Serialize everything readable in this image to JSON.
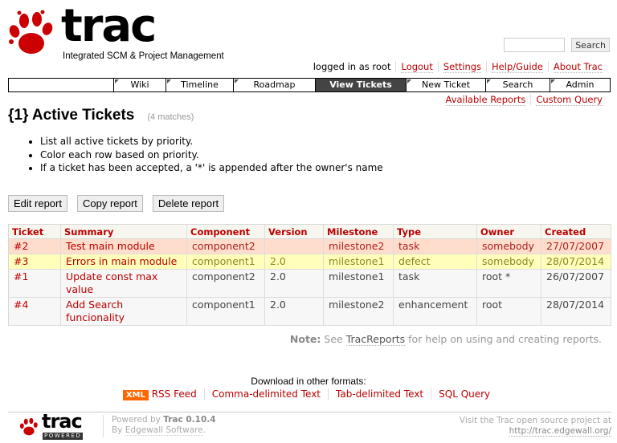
{
  "header": {
    "logo_word": "trac",
    "logo_tagline": "Integrated SCM & Project Management",
    "search_placeholder": "",
    "search_button": "Search"
  },
  "metanav": {
    "logged_in": "logged in as root",
    "items": [
      "Logout",
      "Settings",
      "Help/Guide",
      "About Trac"
    ]
  },
  "mainnav": {
    "tabs": [
      {
        "label": "Wiki",
        "active": false
      },
      {
        "label": "Timeline",
        "active": false
      },
      {
        "label": "Roadmap",
        "active": false
      },
      {
        "label": "View Tickets",
        "active": true
      },
      {
        "label": "New Ticket",
        "active": false
      },
      {
        "label": "Search",
        "active": false
      },
      {
        "label": "Admin",
        "active": false
      }
    ]
  },
  "ctxnav": {
    "items": [
      "Available Reports",
      "Custom Query"
    ]
  },
  "report": {
    "title": "{1} Active Tickets",
    "matches": "(4 matches)",
    "description": [
      "List all active tickets by priority.",
      "Color each row based on priority.",
      "If a ticket has been accepted, a '*' is appended after the owner's name"
    ],
    "buttons": {
      "edit": "Edit report",
      "copy": "Copy report",
      "delete": "Delete report"
    }
  },
  "table": {
    "columns": [
      "Ticket",
      "Summary",
      "Component",
      "Version",
      "Milestone",
      "Type",
      "Owner",
      "Created"
    ],
    "rows": [
      {
        "ticket": "#2",
        "summary": "Test main module",
        "component": "component2",
        "version": "",
        "milestone": "milestone2",
        "type": "task",
        "owner": "somebody",
        "created": "27/07/2007",
        "priority_color": "#ffddcc"
      },
      {
        "ticket": "#3",
        "summary": "Errors in main module",
        "component": "component1",
        "version": "2.0",
        "milestone": "milestone1",
        "type": "defect",
        "owner": "somebody",
        "created": "28/07/2014",
        "priority_color": "#ffffbb"
      },
      {
        "ticket": "#1",
        "summary": "Update const max value",
        "component": "component2",
        "version": "2.0",
        "milestone": "milestone1",
        "type": "task",
        "owner": "root *",
        "created": "26/07/2007",
        "priority_color": "#f7f7f7"
      },
      {
        "ticket": "#4",
        "summary": "Add Search funcionality",
        "component": "component1",
        "version": "2.0",
        "milestone": "milestone2",
        "type": "enhancement",
        "owner": "root",
        "created": "28/07/2014",
        "priority_color": "#f7f7f7"
      }
    ]
  },
  "note": {
    "label": "Note:",
    "pre": "See",
    "link": "TracReports",
    "post": "for help on using and creating reports."
  },
  "altlinks": {
    "heading": "Download in other formats:",
    "xml_badge": "XML",
    "items": [
      "RSS Feed",
      "Comma-delimited Text",
      "Tab-delimited Text",
      "SQL Query"
    ]
  },
  "footer": {
    "logo_word": "trac",
    "logo_sub": "POWERED",
    "powered_pre": "Powered by",
    "powered_version": "Trac 0.10.4",
    "by": "By",
    "by_link": "Edgewall Software",
    "visit": "Visit the Trac open source project at",
    "url": "http://trac.edgewall.org/"
  }
}
